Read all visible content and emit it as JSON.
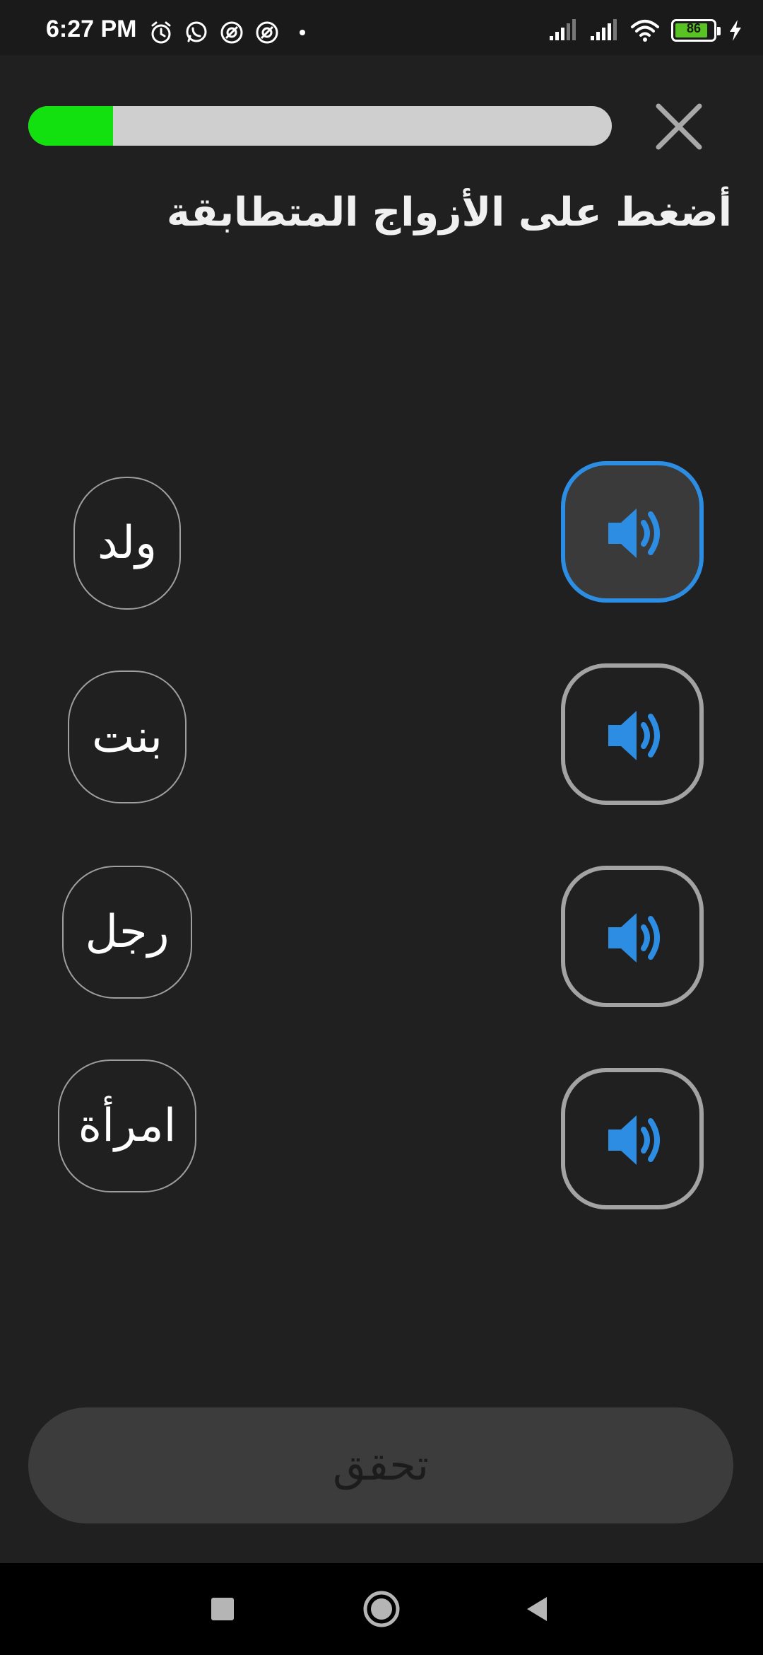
{
  "status_bar": {
    "time": "6:27 PM",
    "battery_level": "86",
    "icons_left": [
      "alarm-icon",
      "whatsapp-icon",
      "app-notification-icon",
      "app-notification-icon",
      "dot-icon"
    ],
    "icons_right": [
      "signal-icon",
      "signal-icon",
      "wifi-icon",
      "battery-icon",
      "charging-icon"
    ]
  },
  "lesson": {
    "progress_fraction": 0.145,
    "progress_color": "#13e00f",
    "instruction": "أضغط على الأزواج المتطابقة"
  },
  "words": [
    {
      "label": "ولد"
    },
    {
      "label": "بنت"
    },
    {
      "label": "رجل"
    },
    {
      "label": "امرأة"
    }
  ],
  "audio_buttons": [
    {
      "icon": "speaker-icon",
      "selected": true
    },
    {
      "icon": "speaker-icon",
      "selected": false
    },
    {
      "icon": "speaker-icon",
      "selected": false
    },
    {
      "icon": "speaker-icon",
      "selected": false
    }
  ],
  "check_button": {
    "label": "تحقق"
  },
  "colors": {
    "accent_blue": "#2c8de3",
    "background": "#202020"
  }
}
